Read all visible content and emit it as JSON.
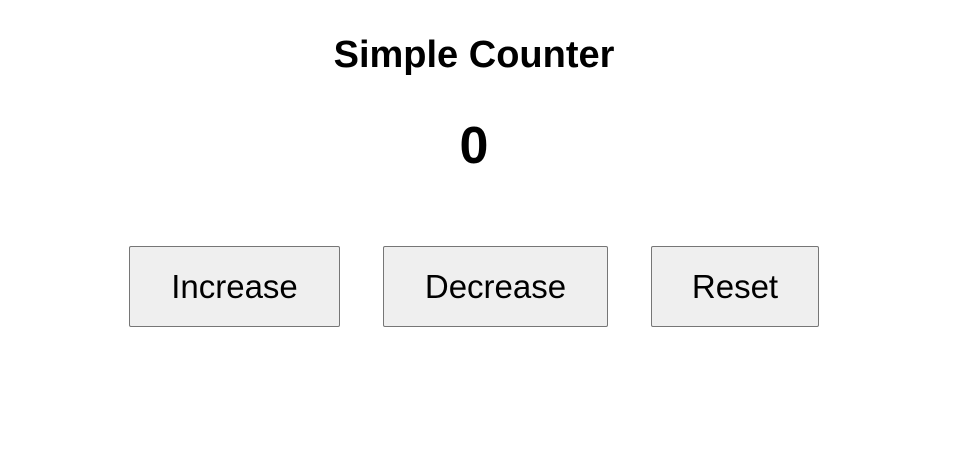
{
  "app": {
    "title": "Simple Counter",
    "count": "0"
  },
  "buttons": {
    "increase_label": "Increase",
    "decrease_label": "Decrease",
    "reset_label": "Reset"
  },
  "colors": {
    "background": "#ffffff",
    "button_background": "#efefef",
    "button_border": "#767676",
    "text": "#000000"
  }
}
